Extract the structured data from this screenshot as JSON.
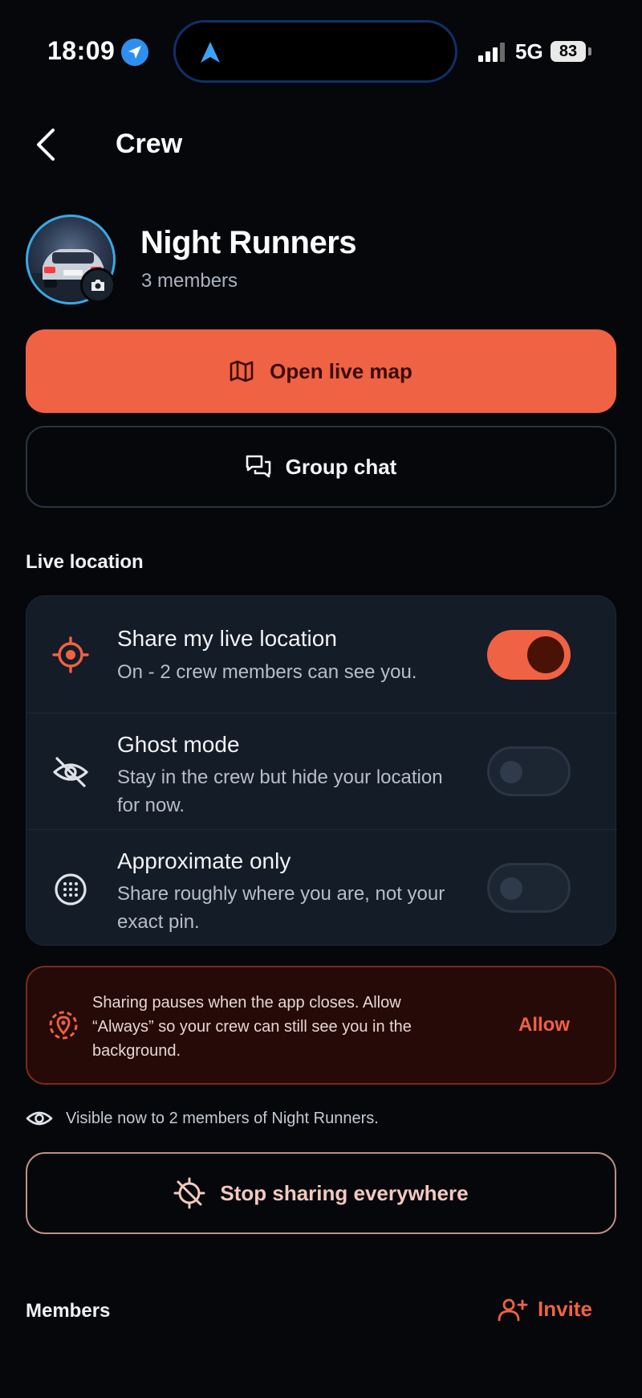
{
  "status_bar": {
    "time": "18:09",
    "network": "5G",
    "battery": "83"
  },
  "header": {
    "title": "Crew"
  },
  "group": {
    "name": "Night Runners",
    "member_count": "3 members"
  },
  "actions": {
    "open_map_label": "Open live map",
    "group_chat_label": "Group chat"
  },
  "live_location": {
    "section_label": "Live location",
    "rows": [
      {
        "title": "Share my live location",
        "subtitle": "On - 2 crew members can see you.",
        "icon": "crosshair-icon",
        "enabled": true
      },
      {
        "title": "Ghost mode",
        "subtitle": "Stay in the crew but hide your location for now.",
        "icon": "eye-off-icon",
        "enabled": false
      },
      {
        "title": "Approximate only",
        "subtitle": "Share roughly where you are, not your exact pin.",
        "icon": "dotted-circle-icon",
        "enabled": false
      }
    ]
  },
  "alert": {
    "text": "Sharing pauses when the app closes. Allow “Always” so your crew can still see you in the background.",
    "action_label": "Allow"
  },
  "visibility": {
    "text": "Visible now to 2 members of Night Runners."
  },
  "stop_button": {
    "label": "Stop sharing everywhere"
  },
  "members": {
    "section_label": "Members",
    "invite_label": "Invite"
  },
  "colors": {
    "accent": "#f06244",
    "background": "#05070b",
    "card": "#141c27"
  }
}
